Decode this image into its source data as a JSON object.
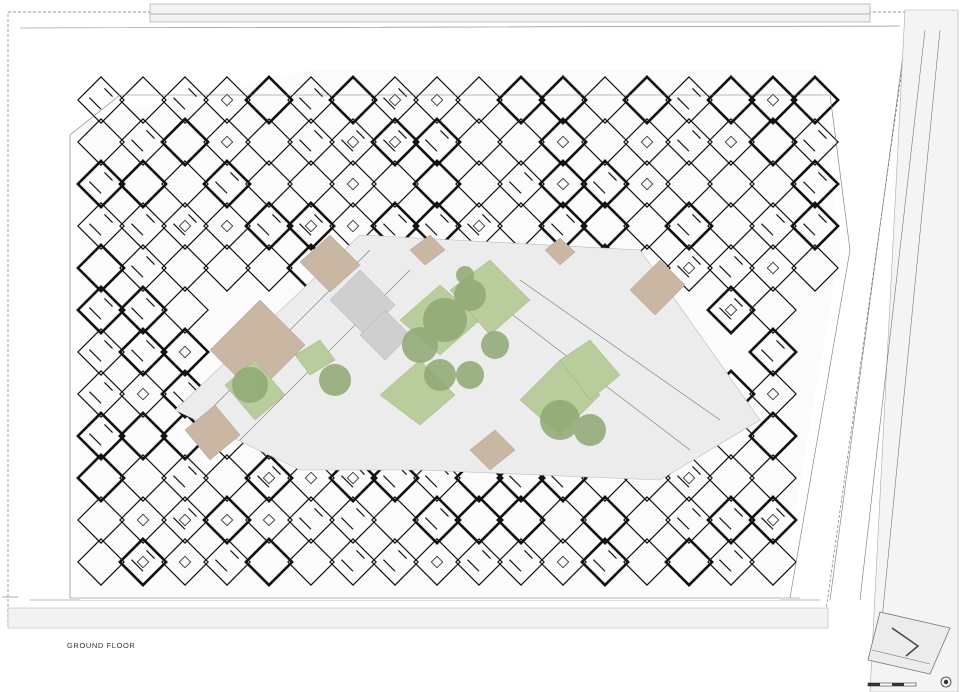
{
  "drawing": {
    "label": "GROUND FLOOR"
  },
  "colors": {
    "background": "#ffffff",
    "walls": "#111111",
    "paving": "#e9e9e9",
    "timber_deck": "#c9b6a3",
    "lawn": "#b8cc9c",
    "tree_canopy": "#8fa874",
    "grey_plaza": "#bdbdbd"
  },
  "symbols": {
    "north_arrow": "north-arrow-icon",
    "scale_bar": "scale-bar-icon",
    "key_plan": "key-plan-icon"
  }
}
